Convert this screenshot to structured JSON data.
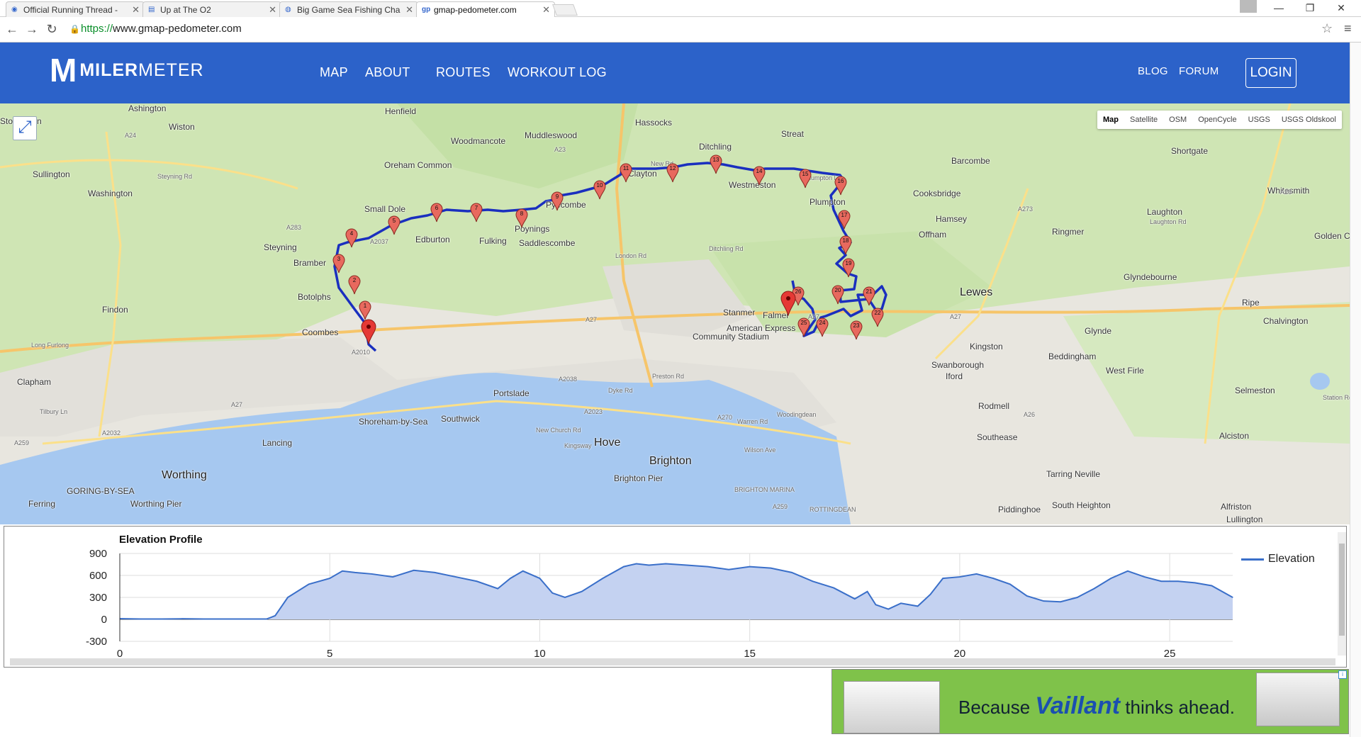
{
  "browser": {
    "tabs": [
      {
        "title": "Official Running Thread -",
        "favicon": "forum-icon"
      },
      {
        "title": "Up at The O2",
        "favicon": "page-icon"
      },
      {
        "title": "Big Game Sea Fishing Cha",
        "favicon": "globe-icon"
      },
      {
        "title": "gmap-pedometer.com",
        "favicon": "gp-icon"
      }
    ],
    "url": {
      "scheme": "https://",
      "rest": "www.gmap-pedometer.com"
    }
  },
  "site": {
    "logo_mark": "M",
    "logo_bold": "MILER",
    "logo_light": "METER",
    "nav": [
      "MAP",
      "ABOUT",
      "ROUTES",
      "WORKOUT LOG"
    ],
    "nav_right": [
      "BLOG",
      "FORUM"
    ],
    "login": "LOGIN",
    "brand_color": "#2c62c9"
  },
  "map": {
    "types": [
      "Map",
      "Satellite",
      "OSM",
      "OpenCycle",
      "USGS",
      "USGS Oldskool"
    ],
    "active_type": "Map",
    "places": [
      "Ashington",
      "Henfield",
      "Hassocks",
      "Storrington",
      "Wiston",
      "Muddleswood",
      "Woodmancote",
      "Ditchling",
      "Streat",
      "Barcombe",
      "Shortgate",
      "Whitesmith",
      "Sullington",
      "Oreham Common",
      "Clayton",
      "Westmeston",
      "Plumpton",
      "Cooksbridge",
      "Washington",
      "Small Dole",
      "Pyecombe",
      "Hamsey",
      "Laughton",
      "Ringmer",
      "Golden Cross",
      "Steyning",
      "Edburton",
      "Fulking",
      "Poynings",
      "Saddlescombe",
      "Offham",
      "Glyndebourne",
      "Bramber",
      "Lewes",
      "Ripe",
      "Botolphs",
      "Findon",
      "Stanmer",
      "Falmer",
      "American Express",
      "Community Stadium",
      "Chalvington",
      "Coombes",
      "Kingston",
      "Glynde",
      "Beddingham",
      "Long Furlong",
      "Swanborough",
      "Iford",
      "West Firle",
      "Clapham",
      "Portslade",
      "Selmeston",
      "Shoreham-by-Sea",
      "Southwick",
      "Rodmell",
      "Lancing",
      "Hove",
      "Woodingdean",
      "Southease",
      "Alciston",
      "Brighton",
      "Worthing",
      "GORING-BY-SEA",
      "Brighton Pier",
      "Tarring Neville",
      "Ferring",
      "Worthing Pier",
      "BRIGHTON MARINA",
      "Piddinghoe",
      "South Heighton",
      "ROTTINGDEAN",
      "Alfriston",
      "Lullington"
    ],
    "roads": [
      "A24",
      "A283",
      "A27",
      "A2037",
      "A23",
      "A273",
      "A26",
      "A270",
      "A259",
      "A2032",
      "A2038",
      "A2023",
      "A2010",
      "London Rd",
      "Preston Rd",
      "Ditchling Rd",
      "New Church Rd",
      "Kingsway",
      "Warren Rd",
      "Wilson Ave",
      "Plumpton Ln",
      "Steyning Rd",
      "New Rd",
      "Laughton Rd",
      "Station Rd",
      "Dyke Rd",
      "Tilbury Ln",
      "Long Furlong"
    ],
    "markers": [
      "1",
      "2",
      "3",
      "4",
      "5",
      "6",
      "7",
      "8",
      "9",
      "10",
      "11",
      "12",
      "13",
      "14",
      "15",
      "16",
      "17",
      "18",
      "19",
      "20",
      "21",
      "22",
      "23",
      "24",
      "25",
      "26"
    ],
    "route_color": "#1a2fbf",
    "marker_color": "#e8695e"
  },
  "elevation": {
    "title": "Elevation Profile",
    "legend": "Elevation",
    "line_color": "#3a6fc9",
    "y_ticks": [
      "900",
      "600",
      "300",
      "0",
      "-300"
    ],
    "x_ticks": [
      "0",
      "5",
      "10",
      "15",
      "20",
      "25"
    ]
  },
  "chart_data": {
    "type": "area",
    "title": "Elevation Profile",
    "xlabel": "",
    "ylabel": "",
    "xlim": [
      0,
      26.5
    ],
    "ylim": [
      -300,
      900
    ],
    "grid": true,
    "legend_position": "right",
    "series": [
      {
        "name": "Elevation",
        "x": [
          0,
          0.5,
          1,
          1.5,
          2,
          2.5,
          3,
          3.5,
          3.7,
          4,
          4.5,
          5,
          5.3,
          5.6,
          6,
          6.5,
          7,
          7.5,
          8,
          8.5,
          9,
          9.3,
          9.6,
          10,
          10.3,
          10.6,
          11,
          11.5,
          12,
          12.3,
          12.6,
          13,
          13.5,
          14,
          14.5,
          15,
          15.5,
          16,
          16.5,
          17,
          17.5,
          17.8,
          18,
          18.3,
          18.6,
          19,
          19.3,
          19.6,
          20,
          20.4,
          20.8,
          21.2,
          21.6,
          22,
          22.4,
          22.8,
          23.2,
          23.6,
          24,
          24.4,
          24.8,
          25.2,
          25.6,
          26,
          26.5
        ],
        "values": [
          10,
          5,
          5,
          8,
          5,
          5,
          5,
          5,
          50,
          300,
          480,
          560,
          660,
          640,
          620,
          580,
          670,
          640,
          580,
          520,
          420,
          560,
          660,
          560,
          360,
          300,
          380,
          560,
          720,
          760,
          740,
          760,
          740,
          720,
          680,
          720,
          700,
          640,
          520,
          430,
          280,
          380,
          200,
          140,
          220,
          180,
          340,
          560,
          580,
          620,
          560,
          480,
          320,
          250,
          240,
          300,
          420,
          560,
          660,
          580,
          520,
          520,
          500,
          460,
          300
        ]
      }
    ]
  },
  "ad": {
    "text_before": "Because",
    "brand": "Vaillant",
    "text_after": "thinks ahead.",
    "bg_color": "#7fc24a"
  }
}
